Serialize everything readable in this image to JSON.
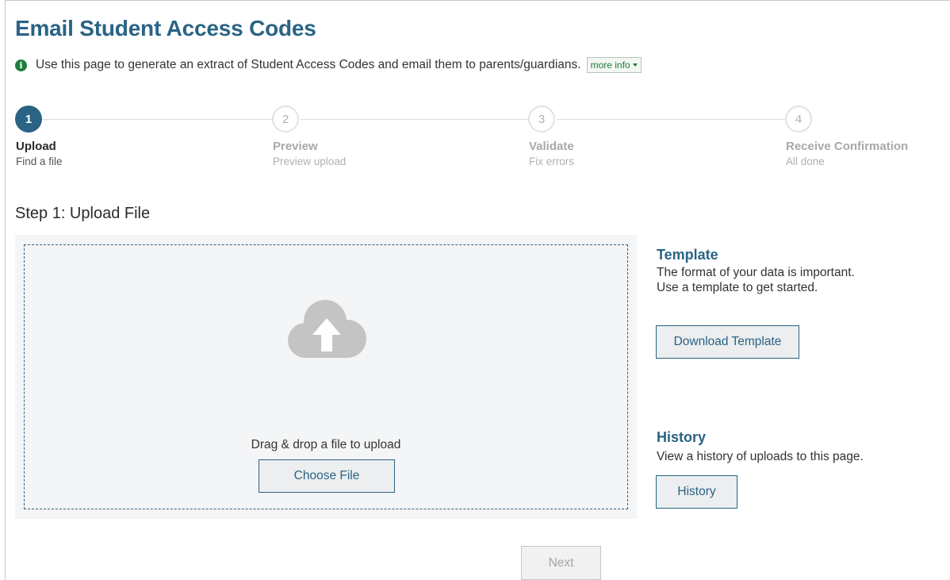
{
  "page": {
    "title": "Email Student Access Codes",
    "info_icon": "info-circle-icon",
    "info_text": "Use this page to generate an extract of Student Access Codes and email them to parents/guardians.",
    "more_info_label": "more info"
  },
  "stepper": {
    "active_index": 1,
    "steps": [
      {
        "number": "1",
        "title": "Upload",
        "subtitle": "Find a file",
        "state": "active"
      },
      {
        "number": "2",
        "title": "Preview",
        "subtitle": "Preview upload",
        "state": "inactive"
      },
      {
        "number": "3",
        "title": "Validate",
        "subtitle": "Fix errors",
        "state": "inactive"
      },
      {
        "number": "4",
        "title": "Receive Confirmation",
        "subtitle": "All done",
        "state": "inactive"
      }
    ]
  },
  "upload": {
    "heading": "Step 1: Upload File",
    "icon": "cloud-upload-icon",
    "drop_text": "Drag & drop a file to upload",
    "choose_label": "Choose File"
  },
  "template": {
    "title": "Template",
    "text": "The format of your data is important. Use a template to get started.",
    "button_label": "Download Template"
  },
  "history": {
    "title": "History",
    "text": "View a history of uploads to this page.",
    "button_label": "History"
  },
  "footer": {
    "next_label": "Next",
    "next_enabled": false
  },
  "colors": {
    "brand": "#2a6384",
    "info_green": "#1e7d3a",
    "panel_bg": "#f4f5f6",
    "disabled_text": "#a5a5a5"
  }
}
